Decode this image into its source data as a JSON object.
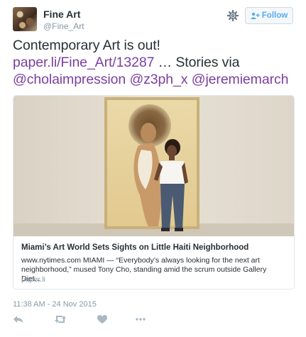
{
  "author": {
    "name": "Fine Art",
    "handle": "@Fine_Art",
    "avatar_icon": "avatar-artwork"
  },
  "header": {
    "settings_icon": "gear-icon",
    "follow_label": "Follow"
  },
  "tweet": {
    "text_prefix": "Contemporary Art is out! ",
    "link": "paper.li/Fine_Art/13287",
    "text_middle": " … Stories via ",
    "mentions": [
      "@cholaimpression",
      "@z3ph_x",
      "@jeremiemarch"
    ]
  },
  "card": {
    "title": "Miami’s Art World Sets Sights on Little Haiti Neighborhood",
    "description": "www.nytimes.com MIAMI — “Everybody’s always looking for the next art neighborhood,” mused Tony Cho, standing amid the scrum outside Gallery Diet...",
    "domain": "paper.li"
  },
  "timestamp": "11:38 AM - 24 Nov 2015",
  "actions": [
    "reply-icon",
    "retweet-icon",
    "like-icon",
    "more-icon"
  ],
  "colors": {
    "link": "#7b3fa0",
    "follow": "#55acee",
    "meta": "#8899a6",
    "text": "#292f33"
  }
}
